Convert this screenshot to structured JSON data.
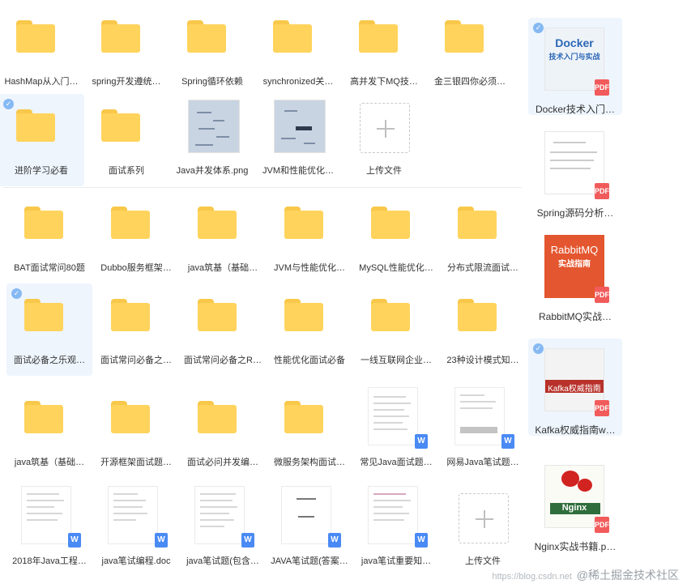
{
  "section1": {
    "items": [
      {
        "label": "HashMap从入门…"
      },
      {
        "label": "spring开发遵统…"
      },
      {
        "label": "Spring循环依赖"
      },
      {
        "label": "synchronized关…"
      },
      {
        "label": "高并发下MQ技…"
      },
      {
        "label": "金三银四你必须…"
      },
      {
        "label": "进阶学习必看"
      },
      {
        "label": "面试系列"
      },
      {
        "label": "Java并发体系.png"
      },
      {
        "label": "JVM和性能优化…"
      },
      {
        "label": "上传文件"
      }
    ]
  },
  "section2": {
    "items": [
      {
        "label": "BAT面试常问80题"
      },
      {
        "label": "Dubbo服务框架…"
      },
      {
        "label": "java筑基（基础…"
      },
      {
        "label": "JVM与性能优化…"
      },
      {
        "label": "MySQL性能优化…"
      },
      {
        "label": "分布式限流面试…"
      },
      {
        "label": "面试必备之乐观…"
      },
      {
        "label": "面试常问必备之…"
      },
      {
        "label": "面试常问必备之R…"
      },
      {
        "label": "性能优化面试必备"
      },
      {
        "label": "一线互联网企业…"
      },
      {
        "label": "23种设计模式知…"
      },
      {
        "label": "java筑基（基础…"
      },
      {
        "label": "开源框架面试题…"
      },
      {
        "label": "面试必问并发编…"
      },
      {
        "label": "微服务架构面试…"
      },
      {
        "label": "常见Java面试题…"
      },
      {
        "label": "网易Java笔试题…"
      },
      {
        "label": "2018年Java工程…"
      },
      {
        "label": "java笔试编程.doc"
      },
      {
        "label": "java笔试题(包含…"
      },
      {
        "label": "JAVA笔试题(答案…"
      },
      {
        "label": "java笔试重要知…"
      },
      {
        "label": "上传文件"
      }
    ]
  },
  "books": [
    {
      "label": "Docker技术入门…",
      "cover_title": "Docker",
      "cover_sub": "技术入门与实战"
    },
    {
      "label": "Spring源码分析…"
    },
    {
      "label": "RabbitMQ实战…",
      "cover_title": "RabbitMQ",
      "cover_sub": "实战指南"
    },
    {
      "label": "Kafka权威指南w…",
      "cover_title": "Kafka权威指南"
    },
    {
      "label": "Nginx实战书籍.p…",
      "cover_title": "Nginx"
    }
  ],
  "watermark": {
    "url": "https://blog.csdn.net",
    "text": "@稀土掘金技术社区"
  },
  "icons": {
    "check": "✓",
    "plus": "+",
    "word_badge": "W",
    "pdf_badge": "PDF"
  },
  "colors": {
    "folder": "#ffd35c",
    "folder_tab": "#f8c84a",
    "selected_bg": "#eef5fd",
    "check": "#86b9f3",
    "pdf": "#f25b5b",
    "word": "#4a8af4"
  }
}
